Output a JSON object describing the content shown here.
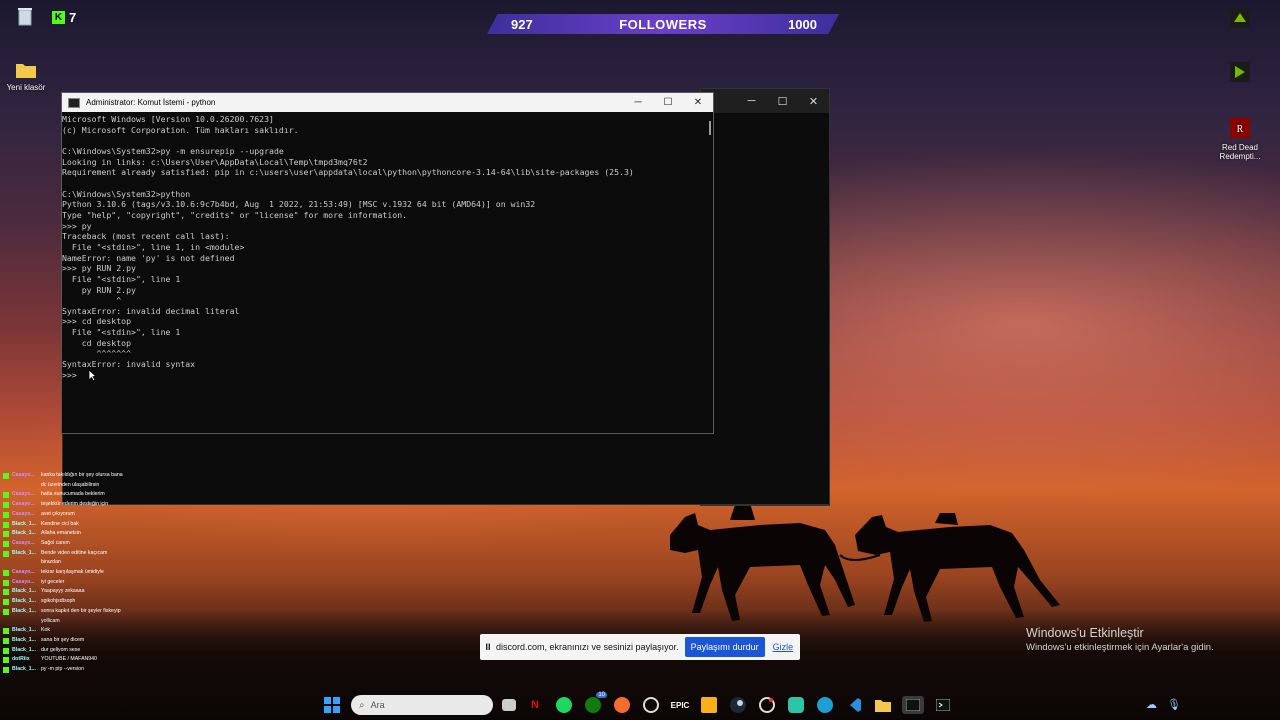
{
  "overlay": {
    "followers_current": "927",
    "followers_label": "FOLLOWERS",
    "followers_goal": "1000",
    "kick_count": "7"
  },
  "desktop_icons": [
    {
      "label": "",
      "icon": "recycle-bin-icon"
    },
    {
      "label": "Yeni klasör",
      "icon": "folder-icon"
    },
    {
      "label": "",
      "icon": "nvidia-app-icon"
    },
    {
      "label": "",
      "icon": "nvidia-broadcast-icon"
    },
    {
      "label": "Red Dead Redempti...",
      "icon": "red-dead-redemption-icon"
    }
  ],
  "terminal": {
    "title": "Administrator: Komut İstemi - python",
    "lines": [
      "Microsoft Windows [Version 10.0.26200.7623]",
      "(c) Microsoft Corporation. Tüm hakları saklıdır.",
      "",
      "C:\\Windows\\System32>py -m ensurepip --upgrade",
      "Looking in links: c:\\Users\\User\\AppData\\Local\\Temp\\tmpd3mq76t2",
      "Requirement already satisfied: pip in c:\\users\\user\\appdata\\local\\python\\pythoncore-3.14-64\\lib\\site-packages (25.3)",
      "",
      "C:\\Windows\\System32>python",
      "Python 3.10.6 (tags/v3.10.6:9c7b4bd, Aug  1 2022, 21:53:49) [MSC v.1932 64 bit (AMD64)] on win32",
      "Type \"help\", \"copyright\", \"credits\" or \"license\" for more information.",
      ">>> py",
      "Traceback (most recent call last):",
      "  File \"<stdin>\", line 1, in <module>",
      "NameError: name 'py' is not defined",
      ">>> py RUN 2.py",
      "  File \"<stdin>\", line 1",
      "    py RUN 2.py",
      "           ^",
      "SyntaxError: invalid decimal literal",
      ">>> cd desktop",
      "  File \"<stdin>\", line 1",
      "    cd desktop",
      "       ^^^^^^^",
      "SyntaxError: invalid syntax",
      ">>> "
    ]
  },
  "chat": [
    {
      "name": "Casayo...",
      "msg": "kanka takıldığın bir şey olursa bana dc üzerinden ulaşabilirsin"
    },
    {
      "name": "Casayo...",
      "msg": "hatta sunucumada beklerim"
    },
    {
      "name": "Casayo...",
      "msg": "teşekkür ederim desteğin için"
    },
    {
      "name": "Casayo...",
      "msg": "avet çıkıyorum"
    },
    {
      "name": "Black_1...",
      "msg": "Kendine cici bak"
    },
    {
      "name": "Black_1...",
      "msg": "Allaha emanetsin"
    },
    {
      "name": "Casayo...",
      "msg": "Sağol canım"
    },
    {
      "name": "Black_1...",
      "msg": "Bende video editine kaçıcam birazdan"
    },
    {
      "name": "Casayo...",
      "msg": "tekrar karşılaşmak ümidiyle"
    },
    {
      "name": "Casayo...",
      "msg": "iyi geceler"
    },
    {
      "name": "Black_1...",
      "msg": "Yaapayyy zekaaaa"
    },
    {
      "name": "Black_1...",
      "msg": "sgikohjsdtsoph"
    },
    {
      "name": "Black_1...",
      "msg": "sonra kapkıt den bir şeyler fiskeyip yollicam"
    },
    {
      "name": "Black_1...",
      "msg": "Kok"
    },
    {
      "name": "Black_1...",
      "msg": "sana bir şey dicem"
    },
    {
      "name": "Black_1...",
      "msg": "dur geliyom sese"
    },
    {
      "name": "dotRiix",
      "msg": "YOUTUBE / MAFAN940"
    },
    {
      "name": "Black_1...",
      "msg": "py -m pip --version"
    }
  ],
  "activation": {
    "title": "Windows'u Etkinleştir",
    "subtitle": "Windows'u etkinleştirmek için Ayarlar'a gidin."
  },
  "share_bar": {
    "message": "discord.com, ekranınızı ve sesinizi paylaşıyor.",
    "stop_label": "Paylaşımı durdur",
    "hide_label": "Gizle"
  },
  "taskbar": {
    "search_placeholder": "Ara",
    "xbox_badge": "10"
  }
}
